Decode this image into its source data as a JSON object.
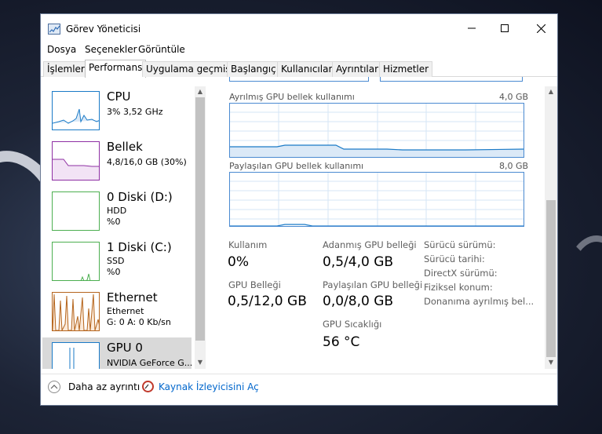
{
  "window": {
    "title": "Görev Yöneticisi"
  },
  "menu": {
    "items": [
      "Dosya",
      "Seçenekler",
      "Görüntüle"
    ]
  },
  "tabs": [
    "İşlemler",
    "Performans",
    "Uygulama geçmişi",
    "Başlangıç",
    "Kullanıcılar",
    "Ayrıntılar",
    "Hizmetler"
  ],
  "sidebar": {
    "items": [
      {
        "title": "CPU",
        "line1": "3%  3,52 GHz",
        "line2": "",
        "color": "#1a7ac7"
      },
      {
        "title": "Bellek",
        "line1": "4,8/16,0 GB (30%)",
        "line2": "",
        "color": "#8e2fa3"
      },
      {
        "title": "0 Diski (D:)",
        "line1": "HDD",
        "line2": "%0",
        "color": "#4caf50"
      },
      {
        "title": "1 Diski (C:)",
        "line1": "SSD",
        "line2": "%0",
        "color": "#4caf50"
      },
      {
        "title": "Ethernet",
        "line1": "Ethernet",
        "line2": "G: 0  A: 0 Kb/sn",
        "color": "#b5651d"
      },
      {
        "title": "GPU 0",
        "line1": "NVIDIA GeForce G...",
        "line2": "",
        "color": "#1a7ac7"
      }
    ]
  },
  "graphs": {
    "dedicated": {
      "label": "Ayrılmış GPU bellek kullanımı",
      "max": "4,0 GB"
    },
    "shared": {
      "label": "Paylaşılan GPU bellek kullanımı",
      "max": "8,0 GB"
    }
  },
  "stats": {
    "usage_label": "Kullanım",
    "usage_value": "0%",
    "dedicated_label": "Adanmış GPU belleği",
    "dedicated_value": "0,5/4,0 GB",
    "gpu_mem_label": "GPU Belleği",
    "gpu_mem_value": "0,5/12,0 GB",
    "shared_label": "Paylaşılan GPU belleği",
    "shared_value": "0,0/8,0 GB",
    "temp_label": "GPU Sıcaklığı",
    "temp_value": "56 °C"
  },
  "details": {
    "driver_version": "Sürücü sürümü:",
    "driver_date": "Sürücü tarihi:",
    "directx": "DirectX sürümü:",
    "physical_location": "Fiziksel konum:",
    "hw_reserved": "Donanıma ayrılmış bel..."
  },
  "footer": {
    "fewer_details": "Daha az ayrıntı",
    "resource_monitor": "Kaynak İzleyicisini Aç"
  }
}
